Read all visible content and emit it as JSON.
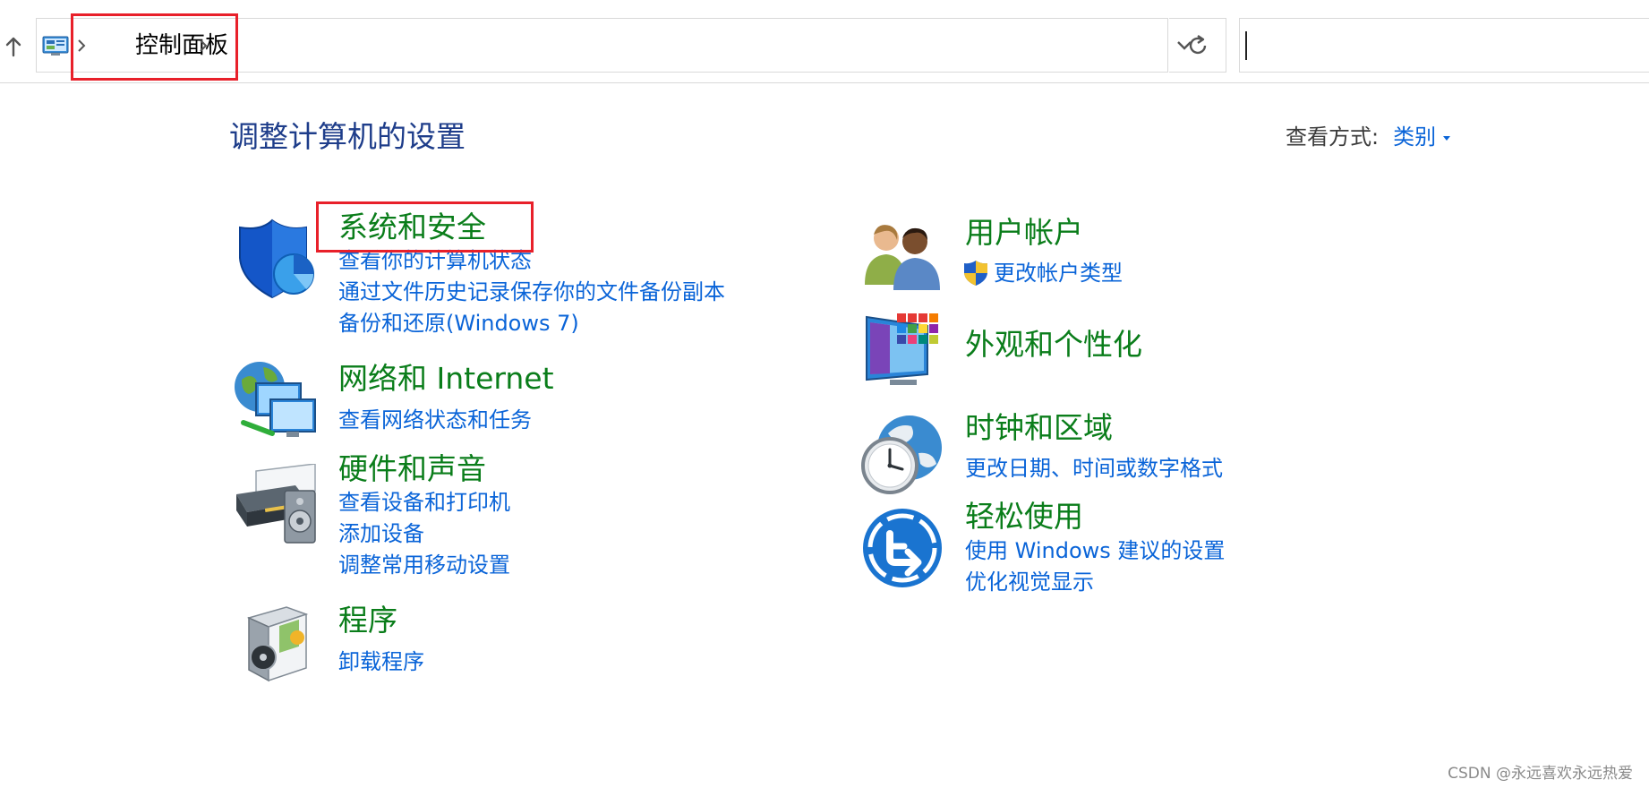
{
  "address_bar": {
    "breadcrumb": "控制面板"
  },
  "header": {
    "title": "调整计算机的设置",
    "view_by_label": "查看方式:",
    "view_by_value": "类别"
  },
  "categories_left": [
    {
      "id": "system-security",
      "title": "系统和安全",
      "links": [
        "查看你的计算机状态",
        "通过文件历史记录保存你的文件备份副本",
        "备份和还原(Windows 7)"
      ]
    },
    {
      "id": "network-internet",
      "title": "网络和 Internet",
      "links": [
        "查看网络状态和任务"
      ]
    },
    {
      "id": "hardware-sound",
      "title": "硬件和声音",
      "links": [
        "查看设备和打印机",
        "添加设备",
        "调整常用移动设置"
      ]
    },
    {
      "id": "programs",
      "title": "程序",
      "links": [
        "卸载程序"
      ]
    }
  ],
  "categories_right": [
    {
      "id": "user-accounts",
      "title": "用户帐户",
      "links": [
        "更改帐户类型"
      ]
    },
    {
      "id": "appearance",
      "title": "外观和个性化",
      "links": []
    },
    {
      "id": "clock-region",
      "title": "时钟和区域",
      "links": [
        "更改日期、时间或数字格式"
      ]
    },
    {
      "id": "ease-of-access",
      "title": "轻松使用",
      "links": [
        "使用 Windows 建议的设置",
        "优化视觉显示"
      ]
    }
  ],
  "watermark": "CSDN @永远喜欢永远热爱",
  "colors": {
    "category_title": "#0a7d1a",
    "link": "#0a64d8",
    "page_title": "#1e3d8a",
    "highlight_box": "#e8202a"
  },
  "icons": {
    "up": "arrow-up-icon",
    "control_panel": "control-panel-icon",
    "dropdown": "chevron-down-icon",
    "refresh": "refresh-icon",
    "uac_shield": "uac-shield-icon"
  }
}
